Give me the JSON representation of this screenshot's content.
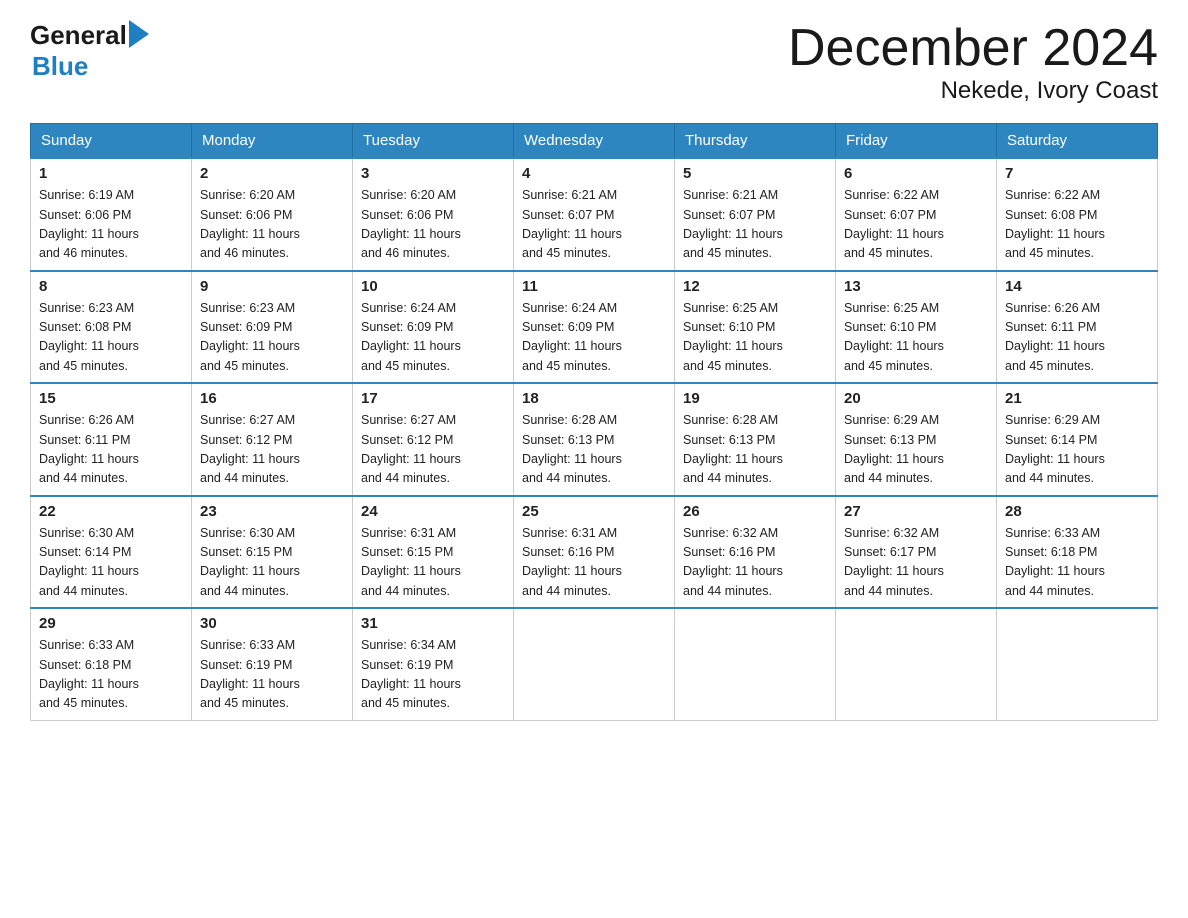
{
  "header": {
    "logo_general": "General",
    "logo_blue": "Blue",
    "month_title": "December 2024",
    "location": "Nekede, Ivory Coast"
  },
  "days_of_week": [
    "Sunday",
    "Monday",
    "Tuesday",
    "Wednesday",
    "Thursday",
    "Friday",
    "Saturday"
  ],
  "weeks": [
    [
      {
        "num": "1",
        "sunrise": "6:19 AM",
        "sunset": "6:06 PM",
        "daylight": "11 hours and 46 minutes."
      },
      {
        "num": "2",
        "sunrise": "6:20 AM",
        "sunset": "6:06 PM",
        "daylight": "11 hours and 46 minutes."
      },
      {
        "num": "3",
        "sunrise": "6:20 AM",
        "sunset": "6:06 PM",
        "daylight": "11 hours and 46 minutes."
      },
      {
        "num": "4",
        "sunrise": "6:21 AM",
        "sunset": "6:07 PM",
        "daylight": "11 hours and 45 minutes."
      },
      {
        "num": "5",
        "sunrise": "6:21 AM",
        "sunset": "6:07 PM",
        "daylight": "11 hours and 45 minutes."
      },
      {
        "num": "6",
        "sunrise": "6:22 AM",
        "sunset": "6:07 PM",
        "daylight": "11 hours and 45 minutes."
      },
      {
        "num": "7",
        "sunrise": "6:22 AM",
        "sunset": "6:08 PM",
        "daylight": "11 hours and 45 minutes."
      }
    ],
    [
      {
        "num": "8",
        "sunrise": "6:23 AM",
        "sunset": "6:08 PM",
        "daylight": "11 hours and 45 minutes."
      },
      {
        "num": "9",
        "sunrise": "6:23 AM",
        "sunset": "6:09 PM",
        "daylight": "11 hours and 45 minutes."
      },
      {
        "num": "10",
        "sunrise": "6:24 AM",
        "sunset": "6:09 PM",
        "daylight": "11 hours and 45 minutes."
      },
      {
        "num": "11",
        "sunrise": "6:24 AM",
        "sunset": "6:09 PM",
        "daylight": "11 hours and 45 minutes."
      },
      {
        "num": "12",
        "sunrise": "6:25 AM",
        "sunset": "6:10 PM",
        "daylight": "11 hours and 45 minutes."
      },
      {
        "num": "13",
        "sunrise": "6:25 AM",
        "sunset": "6:10 PM",
        "daylight": "11 hours and 45 minutes."
      },
      {
        "num": "14",
        "sunrise": "6:26 AM",
        "sunset": "6:11 PM",
        "daylight": "11 hours and 45 minutes."
      }
    ],
    [
      {
        "num": "15",
        "sunrise": "6:26 AM",
        "sunset": "6:11 PM",
        "daylight": "11 hours and 44 minutes."
      },
      {
        "num": "16",
        "sunrise": "6:27 AM",
        "sunset": "6:12 PM",
        "daylight": "11 hours and 44 minutes."
      },
      {
        "num": "17",
        "sunrise": "6:27 AM",
        "sunset": "6:12 PM",
        "daylight": "11 hours and 44 minutes."
      },
      {
        "num": "18",
        "sunrise": "6:28 AM",
        "sunset": "6:13 PM",
        "daylight": "11 hours and 44 minutes."
      },
      {
        "num": "19",
        "sunrise": "6:28 AM",
        "sunset": "6:13 PM",
        "daylight": "11 hours and 44 minutes."
      },
      {
        "num": "20",
        "sunrise": "6:29 AM",
        "sunset": "6:13 PM",
        "daylight": "11 hours and 44 minutes."
      },
      {
        "num": "21",
        "sunrise": "6:29 AM",
        "sunset": "6:14 PM",
        "daylight": "11 hours and 44 minutes."
      }
    ],
    [
      {
        "num": "22",
        "sunrise": "6:30 AM",
        "sunset": "6:14 PM",
        "daylight": "11 hours and 44 minutes."
      },
      {
        "num": "23",
        "sunrise": "6:30 AM",
        "sunset": "6:15 PM",
        "daylight": "11 hours and 44 minutes."
      },
      {
        "num": "24",
        "sunrise": "6:31 AM",
        "sunset": "6:15 PM",
        "daylight": "11 hours and 44 minutes."
      },
      {
        "num": "25",
        "sunrise": "6:31 AM",
        "sunset": "6:16 PM",
        "daylight": "11 hours and 44 minutes."
      },
      {
        "num": "26",
        "sunrise": "6:32 AM",
        "sunset": "6:16 PM",
        "daylight": "11 hours and 44 minutes."
      },
      {
        "num": "27",
        "sunrise": "6:32 AM",
        "sunset": "6:17 PM",
        "daylight": "11 hours and 44 minutes."
      },
      {
        "num": "28",
        "sunrise": "6:33 AM",
        "sunset": "6:18 PM",
        "daylight": "11 hours and 44 minutes."
      }
    ],
    [
      {
        "num": "29",
        "sunrise": "6:33 AM",
        "sunset": "6:18 PM",
        "daylight": "11 hours and 45 minutes."
      },
      {
        "num": "30",
        "sunrise": "6:33 AM",
        "sunset": "6:19 PM",
        "daylight": "11 hours and 45 minutes."
      },
      {
        "num": "31",
        "sunrise": "6:34 AM",
        "sunset": "6:19 PM",
        "daylight": "11 hours and 45 minutes."
      },
      null,
      null,
      null,
      null
    ]
  ],
  "labels": {
    "sunrise": "Sunrise:",
    "sunset": "Sunset:",
    "daylight": "Daylight:"
  }
}
